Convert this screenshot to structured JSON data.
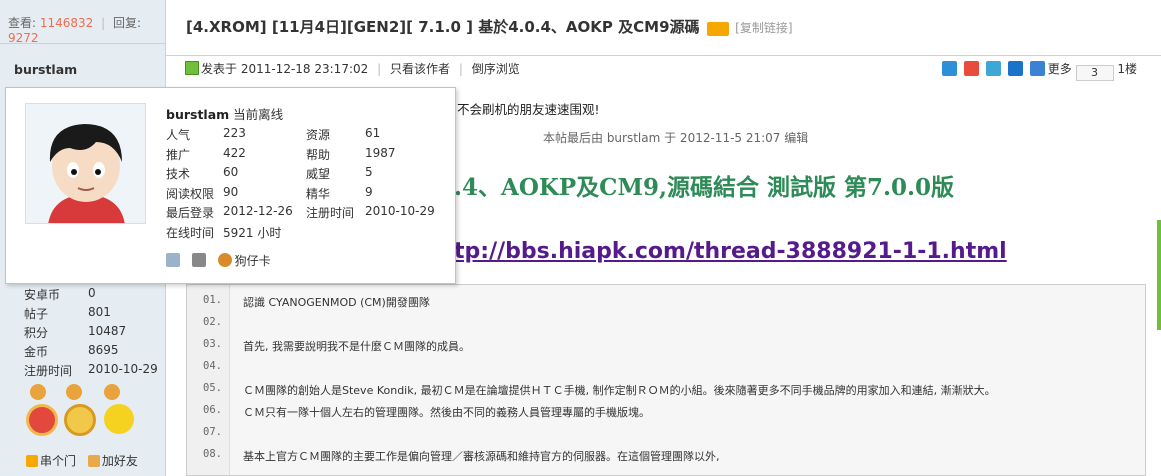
{
  "stats": {
    "views_label": "查看:",
    "views": "1146832",
    "replies_label": "回复:",
    "replies": "9272"
  },
  "thread": {
    "title": "[4.XROM] [11月4日][GEN2][ 7.1.0 ]  基於4.0.4、AOKP 及CM9源碼",
    "copy_link": "[复制链接]"
  },
  "author": {
    "name": "burstlam"
  },
  "post_meta": {
    "posted": "发表于 2011-12-18 23:17:02",
    "only_author": "只看该作者",
    "reverse": "倒序浏览",
    "more": "更多",
    "page_input": "3",
    "floor": "1楼"
  },
  "popup": {
    "name": "burstlam",
    "status": "当前离线",
    "rows": [
      {
        "k1": "人气",
        "v1": "223",
        "k2": "资源",
        "v2": "61"
      },
      {
        "k1": "推广",
        "v1": "422",
        "k2": "帮助",
        "v2": "1987"
      },
      {
        "k1": "技术",
        "v1": "60",
        "k2": "威望",
        "v2": "5"
      },
      {
        "k1": "阅读权限",
        "v1": "90",
        "k2": "精华",
        "v2": "9"
      },
      {
        "k1": "最后登录",
        "v1": "2012-12-26",
        "k2": "注册时间",
        "v2": "2010-10-29"
      }
    ],
    "online_label": "在线时间",
    "online_value": "5921 小时",
    "card_label": "狗仔卡"
  },
  "profile": [
    {
      "k": "安卓币",
      "v": "0"
    },
    {
      "k": "帖子",
      "v": "801"
    },
    {
      "k": "积分",
      "v": "10487"
    },
    {
      "k": "金币",
      "v": "8695"
    },
    {
      "k": "注册时间",
      "v": "2010-10-29"
    }
  ],
  "friends": {
    "visit": "串个门",
    "add": "加好友"
  },
  "post": {
    "intro": "不会刷机的朋友速速围观!",
    "edited": "本帖最后由 burstlam 于 2012-11-5 21:07 编辑",
    "headline": ".4、AOKP及CM9,源碼結合 測試版 第7.0.0版",
    "link": "tp://bbs.hiapk.com/thread-3888921-1-1.html"
  },
  "code_lines": [
    {
      "n": "01.",
      "t": "認識 CYANOGENMOD (CM)開發團隊"
    },
    {
      "n": "02.",
      "t": ""
    },
    {
      "n": "03.",
      "t": "首先, 我需要說明我不是什麼ＣＭ團隊的成員。"
    },
    {
      "n": "04.",
      "t": ""
    },
    {
      "n": "05.",
      "t": "ＣＭ團隊的創始人是Steve Kondik, 最初ＣＭ是在論壇提供ＨＴＣ手機, 制作定制ＲＯＭ的小組。後來隨著更多不同手機品牌的用家加入和連結, 漸漸狀大。"
    },
    {
      "n": "06.",
      "t": "ＣＭ只有一隊十個人左右的管理團隊。然後由不同的義務人員管理專屬的手機版塊。"
    },
    {
      "n": "07.",
      "t": ""
    },
    {
      "n": "08.",
      "t": "基本上官方ＣＭ團隊的主要工作是偏向管理／審核源碼和維持官方的伺服器。在這個管理團隊以外,"
    }
  ],
  "colors": {
    "accent_orange": "#f26c4f",
    "headline_green": "#2e8b57",
    "link_purple": "#551a8b",
    "side_bg": "#e5edf2"
  }
}
